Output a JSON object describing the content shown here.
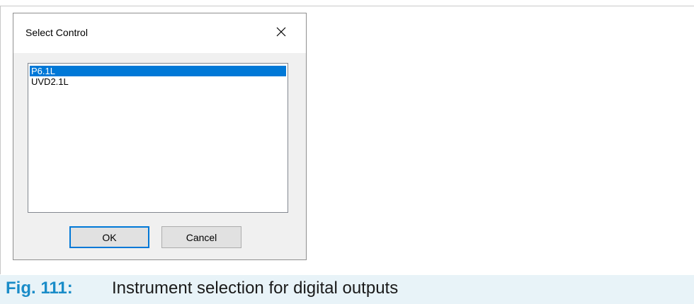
{
  "dialog": {
    "title": "Select Control",
    "close_icon": "close-icon",
    "list_items": [
      "P6.1L",
      "UVD2.1L"
    ],
    "selected_index": 0,
    "ok_label": "OK",
    "cancel_label": "Cancel"
  },
  "caption": {
    "label": "Fig. 111:",
    "text": "Instrument selection for digital outputs"
  },
  "colors": {
    "selection": "#0078d7",
    "caption_accent": "#1a8cc8",
    "caption_background": "#e8f3f8"
  }
}
